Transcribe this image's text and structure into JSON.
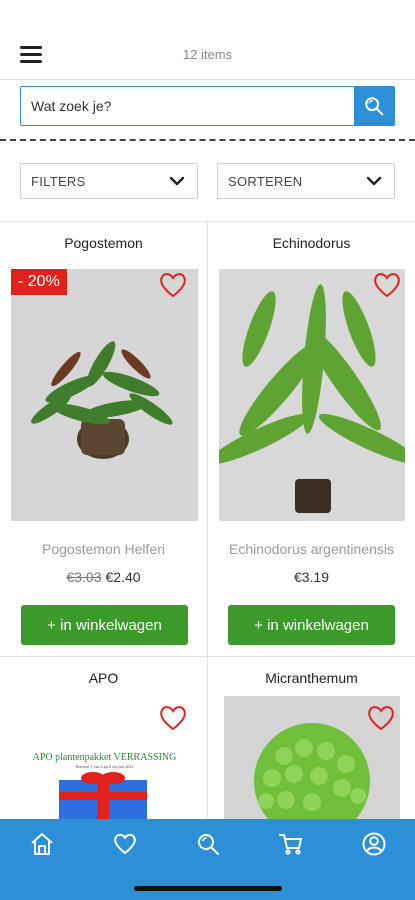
{
  "header": {
    "item_count": "12 items"
  },
  "search": {
    "placeholder": "Wat zoek je?"
  },
  "filters": {
    "filter_label": "FILTERS",
    "sort_label": "SORTEREN"
  },
  "products": [
    {
      "category": "Pogostemon",
      "badge": "- 20%",
      "title": "Pogostemon Helferi",
      "old_price": "€3.03",
      "price": "€2.40",
      "button": "+ in winkelwagen"
    },
    {
      "category": "Echinodorus",
      "badge": "",
      "title": "Echinodorus argentinensis",
      "old_price": "",
      "price": "€3.19",
      "button": "+ in winkelwagen"
    },
    {
      "category": "APO",
      "image_text_1": "APO plantenpakket VERRASSING",
      "image_text_2": "Nummer 1 van 4   april t/m juni 2022"
    },
    {
      "category": "Micranthemum"
    }
  ],
  "colors": {
    "accent": "#2d8fd5",
    "cart_button": "#3b9a2a",
    "sale_badge": "#e3211c",
    "heart": "#e3211c"
  },
  "nav": {
    "items": [
      {
        "icon": "home-icon"
      },
      {
        "icon": "heart-icon"
      },
      {
        "icon": "search-icon"
      },
      {
        "icon": "cart-icon"
      },
      {
        "icon": "account-icon"
      }
    ]
  }
}
